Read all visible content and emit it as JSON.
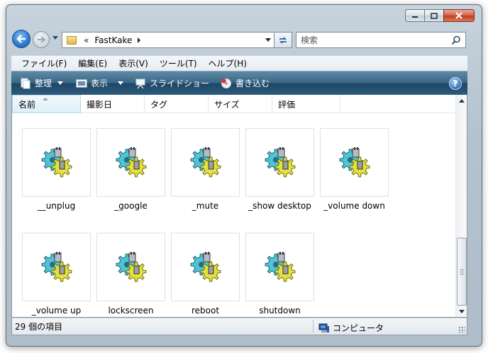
{
  "window": {
    "caption_buttons": [
      "minimize",
      "maximize",
      "close"
    ]
  },
  "address": {
    "overflow_chevron": "«",
    "path": "FastKake"
  },
  "search": {
    "placeholder": "検索"
  },
  "menu": {
    "items": [
      {
        "label": "ファイル(F)"
      },
      {
        "label": "編集(E)"
      },
      {
        "label": "表示(V)"
      },
      {
        "label": "ツール(T)"
      },
      {
        "label": "ヘルプ(H)"
      }
    ]
  },
  "toolbar": {
    "organize_label": "整理",
    "views_label": "表示",
    "slideshow_label": "スライドショー",
    "burn_label": "書き込む",
    "help_label": "?"
  },
  "columns": [
    {
      "label": "名前",
      "sorted": true
    },
    {
      "label": "撮影日"
    },
    {
      "label": "タグ"
    },
    {
      "label": "サイズ"
    },
    {
      "label": "評価"
    }
  ],
  "files": [
    {
      "name": "__unplug"
    },
    {
      "name": "_google"
    },
    {
      "name": "_mute"
    },
    {
      "name": "_show desktop"
    },
    {
      "name": "_volume down"
    },
    {
      "name": "_volume up"
    },
    {
      "name": "lockscreen"
    },
    {
      "name": "reboot"
    },
    {
      "name": "shutdown"
    }
  ],
  "status": {
    "item_count": "29 個の項目",
    "location": "コンピュータ"
  },
  "colors": {
    "toolbar": "#2d5a7c",
    "selection_border": "#b7d6ea"
  }
}
